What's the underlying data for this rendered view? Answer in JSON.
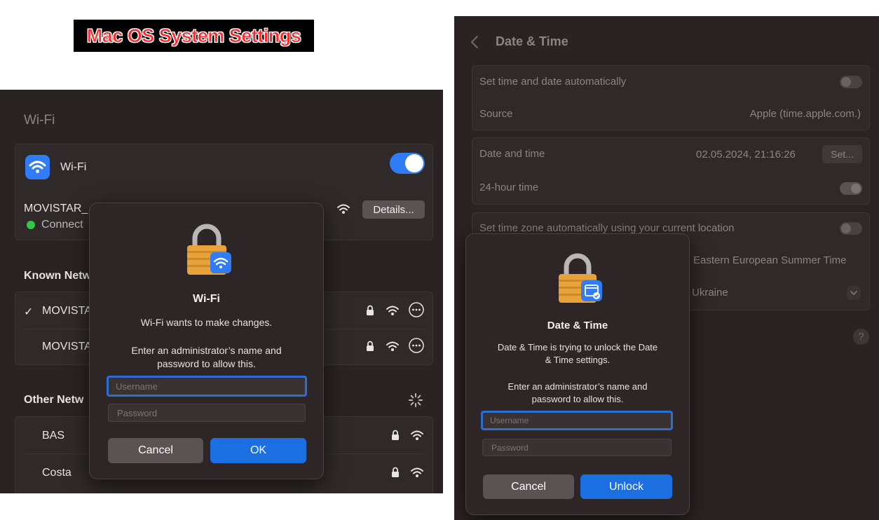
{
  "banner": {
    "title": "Mac OS System Settings"
  },
  "wifi_pane": {
    "header": "Wi-Fi",
    "wifi_label": "Wi-Fi",
    "current_network": "MOVISTAR_",
    "status": "Connect",
    "details_button": "Details...",
    "known_networks_header": "Known Netw",
    "known_networks": [
      {
        "name": "MOVISTA",
        "checked": "✓"
      },
      {
        "name": "MOVISTA",
        "checked": ""
      }
    ],
    "other_networks_header": "Other Netw",
    "other_networks": [
      {
        "name": "BAS"
      },
      {
        "name": "Costa"
      }
    ]
  },
  "wifi_dialog": {
    "title": "Wi-Fi",
    "message": "Wi-Fi wants to make changes.",
    "prompt_line1": "Enter an administrator’s name and",
    "prompt_line2": "password to allow this.",
    "username_placeholder": "Username",
    "password_placeholder": "Password",
    "cancel": "Cancel",
    "ok": "OK"
  },
  "datetime_pane": {
    "header": "Date & Time",
    "set_auto_label": "Set time and date automatically",
    "source_label": "Source",
    "source_value": "Apple (time.apple.com.)",
    "date_time_label": "Date and time",
    "date_time_value": "02.05.2024, 21:16:26",
    "set_button": "Set...",
    "hour24_label": "24-hour time",
    "tz_auto_label": "Set time zone automatically using your current location",
    "timezone_value": "Eastern European Summer Time",
    "city_value": "Ukraine",
    "help": "?"
  },
  "datetime_dialog": {
    "title": "Date & Time",
    "message_line1": "Date & Time is trying to unlock the Date",
    "message_line2": "& Time settings.",
    "prompt_line1": "Enter an administrator’s name and",
    "prompt_line2": "password to allow this.",
    "username_placeholder": "Username",
    "password_placeholder": "Password",
    "cancel": "Cancel",
    "unlock": "Unlock"
  },
  "colors": {
    "accent": "#1b6fe0",
    "background": "#2a2323",
    "status_green": "#30c74b",
    "banner_text": "#ff2a2a"
  }
}
